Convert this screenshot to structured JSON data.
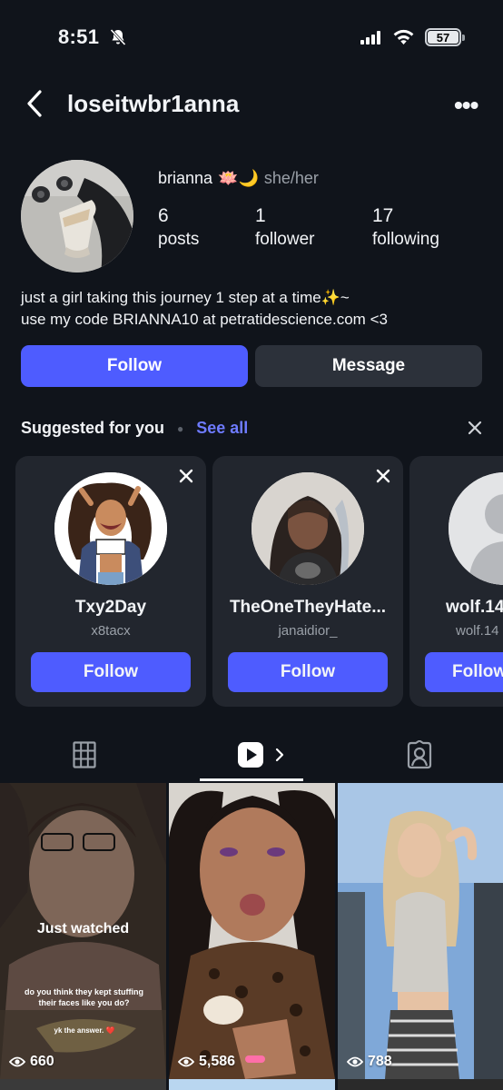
{
  "status_bar": {
    "time": "8:51",
    "battery": "57"
  },
  "header": {
    "username": "loseitwbr1anna"
  },
  "profile": {
    "name": "brianna",
    "emojis": "🪷🌙",
    "pronouns": "she/her",
    "stats": [
      {
        "num": "6",
        "label": "posts"
      },
      {
        "num": "1",
        "label": "follower"
      },
      {
        "num": "17",
        "label": "following"
      }
    ],
    "bio_line1": "just a girl taking this journey 1 step at a time✨~",
    "bio_line2": "use my code BRIANNA10 at petratidescience.com <3",
    "follow_label": "Follow",
    "message_label": "Message"
  },
  "suggested": {
    "heading": "Suggested for you",
    "see_all": "See all",
    "cards": [
      {
        "title": "Txy2Day",
        "sub": "x8tacx",
        "button": "Follow"
      },
      {
        "title": "TheOneTheyHate...",
        "sub": "janaidior_",
        "button": "Follow"
      },
      {
        "title": "wolf.14",
        "sub": "wolf.14",
        "button": "Follow"
      }
    ]
  },
  "tabs": [
    "grid-icon",
    "reels-icon",
    "tagged-icon"
  ],
  "videos": [
    {
      "views": "660",
      "overlay": "Just watched",
      "caption": "do you think they kept stuffing their faces like you do?",
      "caption2": "yk the answer. ❤️"
    },
    {
      "views": "5,586"
    },
    {
      "views": "788"
    }
  ]
}
